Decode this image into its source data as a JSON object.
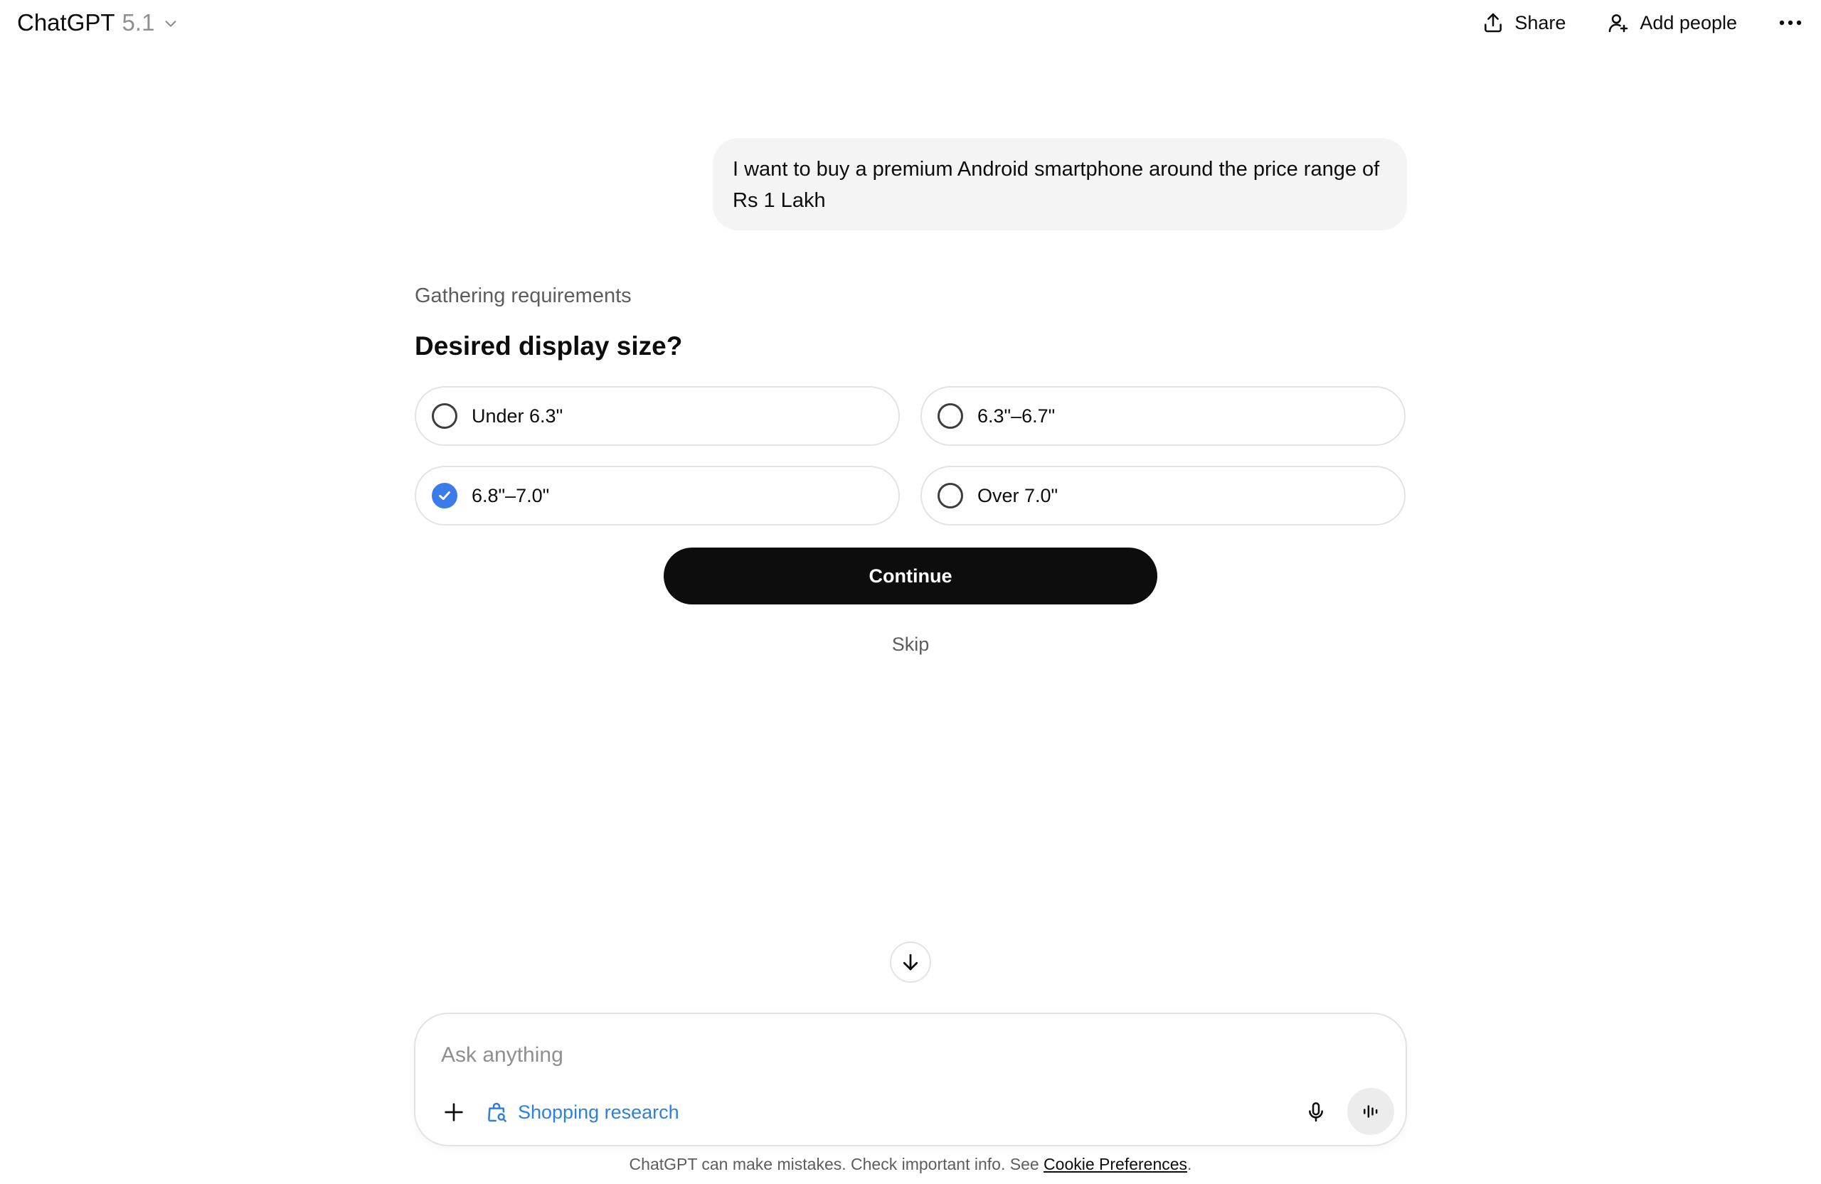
{
  "header": {
    "app_name": "ChatGPT",
    "model_version": "5.1",
    "share_label": "Share",
    "add_people_label": "Add people"
  },
  "conversation": {
    "user_message": "I want to buy a premium Android smartphone around the price range of Rs 1 Lakh"
  },
  "requirements": {
    "status": "Gathering requirements",
    "question": "Desired display size?",
    "options": [
      {
        "label": "Under 6.3\"",
        "selected": false
      },
      {
        "label": "6.3\"–6.7\"",
        "selected": false
      },
      {
        "label": "6.8\"–7.0\"",
        "selected": true
      },
      {
        "label": "Over 7.0\"",
        "selected": false
      }
    ],
    "continue_label": "Continue",
    "skip_label": "Skip"
  },
  "composer": {
    "placeholder": "Ask anything",
    "tool_label": "Shopping research"
  },
  "footer": {
    "disclaimer_text": "ChatGPT can make mistakes. Check important info. See ",
    "cookie_link": "Cookie Preferences",
    "disclaimer_end": "."
  },
  "colors": {
    "accent": "#3b7bea",
    "tool_blue": "#2f7fde",
    "primary_button": "#0d0d0d",
    "bubble_bg": "#f4f4f4"
  },
  "icons": [
    "chevron-down-icon",
    "share-icon",
    "add-person-icon",
    "more-icon",
    "checkmark-icon",
    "arrow-down-icon",
    "plus-icon",
    "shopping-bag-search-icon",
    "microphone-icon",
    "voice-waveform-icon"
  ]
}
